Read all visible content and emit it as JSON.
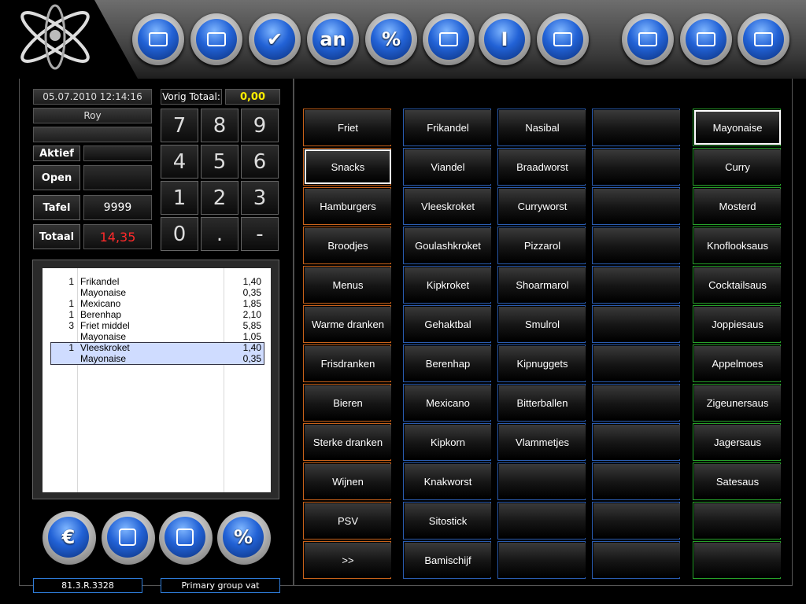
{
  "topbar": {
    "logo_icon": "atom-logo-icon",
    "buttons": [
      {
        "icon": "table-icon"
      },
      {
        "icon": "ticket-transfer-icon"
      },
      {
        "icon": "checkmark-icon",
        "label": "✔"
      },
      {
        "icon": "table-an-icon",
        "label": "an"
      },
      {
        "icon": "percent-doc-icon",
        "label": "%"
      },
      {
        "icon": "report-icon"
      },
      {
        "icon": "info-icon",
        "label": "I"
      },
      {
        "icon": "bag-icon"
      },
      {
        "icon": "waiter-icon"
      },
      {
        "icon": "manager-icon"
      },
      {
        "icon": "exit-icon"
      }
    ]
  },
  "left": {
    "datetime": "05.07.2010 12:14:16",
    "user": "Roy",
    "vorig_totaal_label": "Vorig Totaal:",
    "vorig_totaal_value": "0,00",
    "aktief_label": "Aktief",
    "open_label": "Open",
    "tafel_label": "Tafel",
    "tafel_value": "9999",
    "totaal_label": "Totaal",
    "totaal_value": "14,35",
    "keypad": [
      "7",
      "8",
      "9",
      "4",
      "5",
      "6",
      "1",
      "2",
      "3",
      "0",
      ".",
      "-"
    ],
    "receipt": [
      {
        "qty": "1",
        "name": "Frikandel",
        "price": "1,40"
      },
      {
        "qty": "",
        "name": "Mayonaise",
        "price": "0,35"
      },
      {
        "qty": "1",
        "name": "Mexicano",
        "price": "1,85"
      },
      {
        "qty": "1",
        "name": "Berenhap",
        "price": "2,10"
      },
      {
        "qty": "3",
        "name": "Friet middel",
        "price": "5,85"
      },
      {
        "qty": "",
        "name": "Mayonaise",
        "price": "1,05"
      },
      {
        "qty": "1",
        "name": "Vleeskroket",
        "price": "1,40"
      },
      {
        "qty": "",
        "name": "Mayonaise",
        "price": "0,35"
      }
    ],
    "bottom_buttons": [
      {
        "icon": "euro-icon",
        "label": "€"
      },
      {
        "icon": "coins-icon"
      },
      {
        "icon": "calculator-icon"
      },
      {
        "icon": "percent-icon",
        "label": "%"
      }
    ],
    "version": "81.3.R.3328",
    "vat_group": "Primary group vat"
  },
  "groups": [
    "Friet",
    "Snacks",
    "Hamburgers",
    "Broodjes",
    "Menus",
    "Warme dranken",
    "Frisdranken",
    "Bieren",
    "Sterke dranken",
    "Wijnen",
    "PSV",
    ">>"
  ],
  "products_col1": [
    "Frikandel",
    "Viandel",
    "Vleeskroket",
    "Goulashkroket",
    "Kipkroket",
    "Gehaktbal",
    "Berenhap",
    "Mexicano",
    "Kipkorn",
    "Knakworst",
    "Sitostick",
    "Bamischijf"
  ],
  "products_col2": [
    "Nasibal",
    "Braadworst",
    "Curryworst",
    "Pizzarol",
    "Shoarmarol",
    "Smulrol",
    "Kipnuggets",
    "Bitterballen",
    "Vlammetjes",
    "",
    "",
    ""
  ],
  "products_col3": [
    "",
    "",
    "",
    "",
    "",
    "",
    "",
    "",
    "",
    "",
    "",
    ""
  ],
  "sauces": [
    "Mayonaise",
    "Curry",
    "Mosterd",
    "Knoflooksaus",
    "Cocktailsaus",
    "Joppiesaus",
    "Appelmoes",
    "Zigeunersaus",
    "Jagersaus",
    "Satesaus",
    "",
    ""
  ],
  "colors": {
    "orange": "#c8621a",
    "blue": "#2a5cb0",
    "green": "#27a12a",
    "total": "#ff2a2a",
    "prev_total": "#ffee00"
  }
}
